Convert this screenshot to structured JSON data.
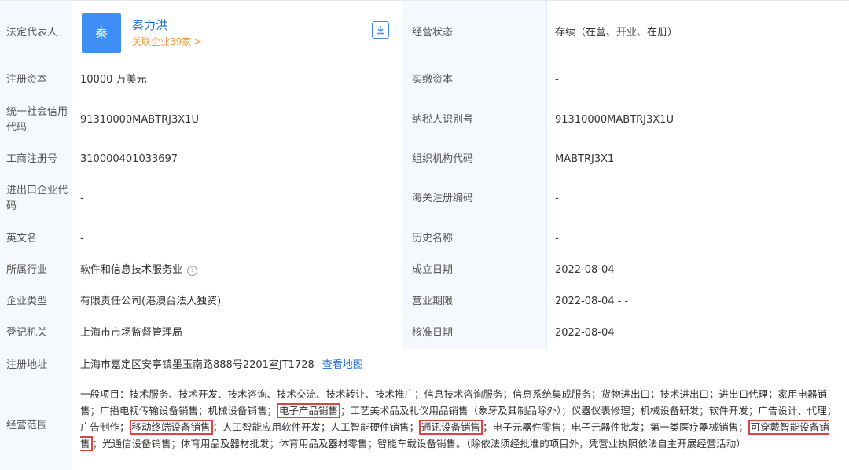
{
  "rows": {
    "legal_rep": {
      "label": "法定代表人",
      "avatar_char": "秦",
      "name": "秦力洪",
      "related": "关联企业39家 >",
      "label2": "经营状态",
      "value2": "存续（在营、开业、在册）"
    },
    "reg_capital": {
      "label": "注册资本",
      "value": "10000 万美元",
      "label2": "实缴资本",
      "value2": "-"
    },
    "credit_code": {
      "label": "统一社会信用代码",
      "value": "91310000MABTRJ3X1U",
      "label2": "纳税人识别号",
      "value2": "91310000MABTRJ3X1U"
    },
    "biz_reg_no": {
      "label": "工商注册号",
      "value": "310000401033697",
      "label2": "组织机构代码",
      "value2": "MABTRJ3X1"
    },
    "import_export": {
      "label": "进出口企业代码",
      "value": "-",
      "label2": "海关注册编码",
      "value2": "-"
    },
    "english_name": {
      "label": "英文名",
      "value": "-",
      "label2": "历史名称",
      "value2": "-"
    },
    "industry": {
      "label": "所属行业",
      "value": "软件和信息技术服务业",
      "help": "?",
      "label2": "成立日期",
      "value2": "2022-08-04"
    },
    "company_type": {
      "label": "企业类型",
      "value": "有限责任公司(港澳台法人独资)",
      "label2": "营业期限",
      "value2": "2022-08-04 - -"
    },
    "authority": {
      "label": "登记机关",
      "value": "上海市市场监督管理局",
      "label2": "核准日期",
      "value2": "2022-08-04"
    },
    "address": {
      "label": "注册地址",
      "value": "上海市嘉定区安亭镇墨玉南路888号2201室JT1728",
      "map_link": "查看地图"
    },
    "scope": {
      "label": "经营范围",
      "t1": "一般项目：技术服务、技术开发、技术咨询、技术交流、技术转让、技术推广；信息技术咨询服务；信息系统集成服务；货物进出口；技术进出口；进出口代理；家用电器销售；广播电视传输设备销售；机械设备销售；",
      "h1": "电子产品销售",
      "t2": "；工艺美术品及礼仪用品销售（象牙及其制品除外）；仪器仪表修理；机械设备研发；软件开发；广告设计、代理；广告制作；",
      "h2": "移动终端设备销售",
      "t3": "；人工智能应用软件开发；人工智能硬件销售；",
      "h3": "通讯设备销售",
      "t4": "；电子元器件零售；电子元器件批发；第一类医疗器械销售；",
      "h4": "可穿戴智能设备销售",
      "t5": "；光通信设备销售；体育用品及器材批发；体育用品及器材零售；智能车载设备销售。（除依法须经批准的项目外，凭营业执照依法自主开展经营活动）"
    }
  },
  "icons": {
    "download": "download-icon",
    "help": "question-circle-icon"
  },
  "colors": {
    "link": "#1f6fd6",
    "accent": "#3f8ef4",
    "orange": "#f09a3a",
    "highlight": "#d94545",
    "label_bg": "#f5f8fc"
  }
}
